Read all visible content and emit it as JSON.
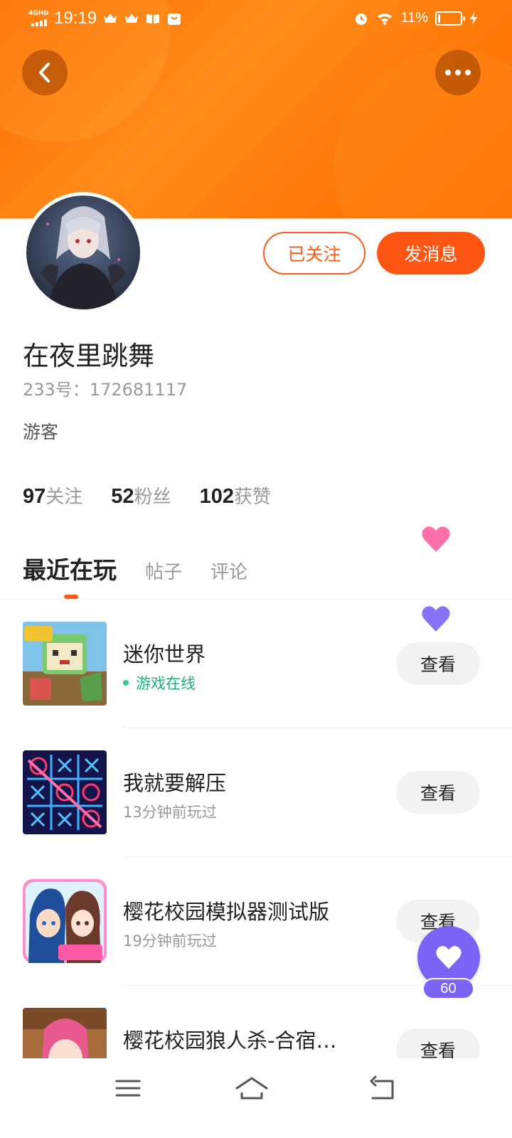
{
  "status_bar": {
    "network": "4GHD",
    "time": "19:19",
    "battery_percent": "11%",
    "battery_level": 0.11
  },
  "header": {
    "back_icon": "chevron-left-icon",
    "more_icon": "more-dots-icon"
  },
  "profile": {
    "name": "在夜里跳舞",
    "id_text": "233号：172681117",
    "role": "游客",
    "follow_button": "已关注",
    "message_button": "发消息",
    "stats": [
      {
        "num": "97",
        "label": "关注"
      },
      {
        "num": "52",
        "label": "粉丝"
      },
      {
        "num": "102",
        "label": "获赞"
      }
    ]
  },
  "tabs": [
    "最近在玩",
    "帖子",
    "评论"
  ],
  "games": [
    {
      "title": "迷你世界",
      "subtitle": "游戏在线",
      "online": true,
      "button": "查看"
    },
    {
      "title": "我就要解压",
      "subtitle": "13分钟前玩过",
      "online": false,
      "button": "查看"
    },
    {
      "title": "樱花校园模拟器测试版",
      "subtitle": "19分钟前玩过",
      "online": false,
      "button": "查看"
    },
    {
      "title": "樱花校园狼人杀-合宿…",
      "subtitle": "",
      "online": false,
      "button": "查看"
    }
  ],
  "like_fab": {
    "count": "60"
  },
  "colors": {
    "accent": "#ff5512",
    "online_green": "#1db07a",
    "fab_purple": "#7a64f5",
    "heart_pink": "#ff6fa8"
  }
}
